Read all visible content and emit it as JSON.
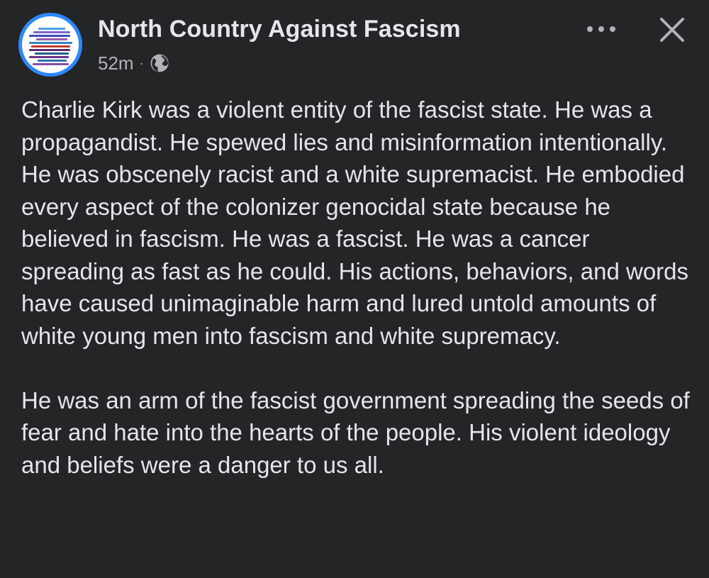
{
  "post": {
    "page_name": "North Country Against Fascism",
    "timestamp": "52m",
    "separator": "·",
    "audience_icon": "globe-icon",
    "more_icon": "more-dots-icon",
    "close_icon": "close-icon",
    "paragraphs": [
      "Charlie Kirk was a violent entity of the fascist state. He was a propagandist. He spewed lies and misinformation intentionally. He was obscenely racist and a white supremacist. He embodied every aspect of the colonizer genocidal state because he believed in fascism. He was a fascist. He was a cancer spreading as fast as he could. His actions, behaviors, and words have caused unimaginable harm and lured untold amounts of white young men into fascism and white supremacy.",
      "He was an arm of the fascist government spreading the seeds of fear and hate into the hearts of the people. His violent ideology and beliefs were a danger to us all."
    ]
  },
  "colors": {
    "background": "#242526",
    "primary_text": "#e4e6eb",
    "secondary_text": "#b0b3b8",
    "avatar_ring": "#2d88ff"
  }
}
